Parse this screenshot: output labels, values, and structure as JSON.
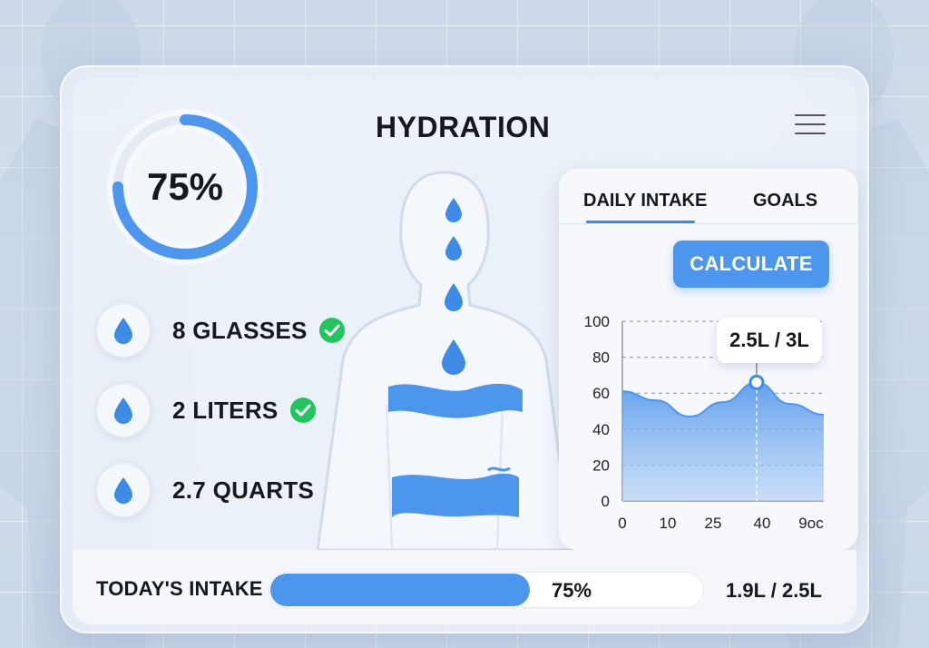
{
  "app": {
    "title": "HYDRATION"
  },
  "progress": {
    "percent_label": "75%",
    "fraction": 0.75
  },
  "stats": [
    {
      "label": "8 GLASSES",
      "icon": "water-drop-icon",
      "status_icon": "check-circle-icon"
    },
    {
      "label": "2 LITERS",
      "icon": "water-drop-icon",
      "status_icon": "check-circle-icon"
    },
    {
      "label": "2.7 QUARTS",
      "icon": "water-drop-icon",
      "status_icon": "check-circle-icon"
    }
  ],
  "tabs": {
    "daily_intake": "DAILY INTAKE",
    "goals": "GOALS",
    "active": "daily_intake"
  },
  "calculate_label": "CALCULATE",
  "tooltip": "2.5L / 3L",
  "chart_data": {
    "type": "area",
    "x_ticks": [
      "0",
      "10",
      "25",
      "40",
      "9oc"
    ],
    "y_ticks": [
      "0",
      "20",
      "40",
      "60",
      "80",
      "100"
    ],
    "ylim": [
      0,
      100
    ],
    "x": [
      0,
      1,
      2,
      3,
      4,
      5,
      6
    ],
    "values": [
      61,
      56,
      47,
      55,
      66,
      54,
      48
    ],
    "highlight_index": 4,
    "grid": true,
    "title": "",
    "xlabel": "",
    "ylabel": ""
  },
  "footer": {
    "label": "TODAY'S INTAKE",
    "percent": "75%",
    "fraction": 0.75,
    "amount": "1.9L / 2.5L"
  },
  "colors": {
    "accent": "#4d96ee",
    "check": "#22c55e",
    "text": "#15181d"
  }
}
